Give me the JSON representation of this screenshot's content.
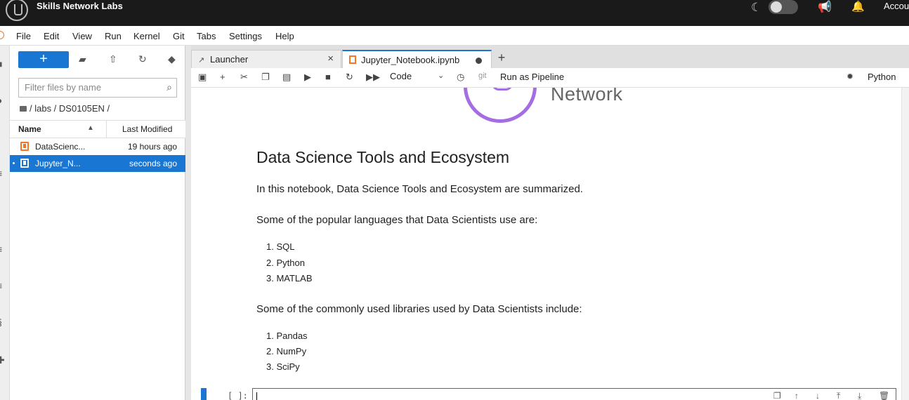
{
  "topbar": {
    "brand": "Skills Network Labs",
    "account": "Accou"
  },
  "menu": [
    "File",
    "Edit",
    "View",
    "Run",
    "Kernel",
    "Git",
    "Tabs",
    "Settings",
    "Help"
  ],
  "filebrowser": {
    "new_label": "+",
    "filter_placeholder": "Filter files by name",
    "breadcrumb": "/ labs / DS0105EN /",
    "col_name": "Name",
    "col_modified": "Last Modified",
    "files": [
      {
        "name": "DataScienc...",
        "modified": "19 hours ago",
        "selected": false
      },
      {
        "name": "Jupyter_N...",
        "modified": "seconds ago",
        "selected": true
      }
    ]
  },
  "tabs": [
    {
      "label": "Launcher",
      "active": false
    },
    {
      "label": "Jupyter_Notebook.ipynb",
      "active": true
    }
  ],
  "toolbar": {
    "cell_type": "Code",
    "git": "git",
    "pipeline": "Run as Pipeline",
    "kernel": "Python"
  },
  "notebook": {
    "logo_word": "Network",
    "title": "Data Science Tools and Ecosystem",
    "intro": "In this notebook, Data Science Tools and Ecosystem are summarized.",
    "languages_heading": "Some of the popular languages that Data Scientists use are:",
    "languages": [
      "1. SQL",
      "2. Python",
      "3. MATLAB"
    ],
    "libraries_heading": "Some of the commonly used libraries used by Data Scientists include:",
    "libraries": [
      "1. Pandas",
      "2. NumPy",
      "3. SciPy"
    ],
    "prompt": "[ ]:"
  },
  "colors": {
    "accent": "#1976d2",
    "topbar": "#1a1a1a",
    "notebook_icon": "#f37726",
    "logo": "#a56de2"
  }
}
